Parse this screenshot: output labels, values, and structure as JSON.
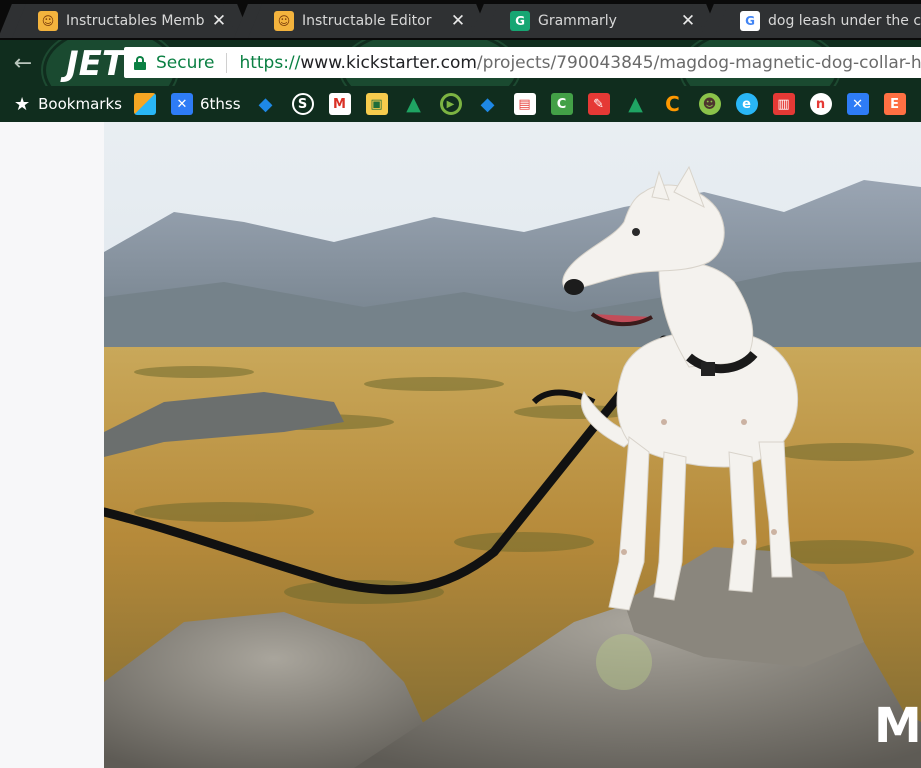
{
  "tabs": [
    {
      "title": "Instructables Membe",
      "favicon": "instructables-icon",
      "close": "✕"
    },
    {
      "title": "Instructable Editor",
      "favicon": "instructables-icon",
      "close": "✕"
    },
    {
      "title": "Grammarly",
      "favicon": "grammarly-icon",
      "close": "✕"
    },
    {
      "title": "dog leash under the c",
      "favicon": "google-icon",
      "close": "✕"
    }
  ],
  "toolbar": {
    "back": "←",
    "security_label": "Secure",
    "url": {
      "scheme": "https://",
      "host": "www.kickstarter.com",
      "path": "/projects/790043845/magdog-magnetic-dog-collar-h"
    },
    "theme_text": "JETS"
  },
  "bookmarks": {
    "label": "Bookmarks",
    "items": [
      {
        "icon": "folder-colorful-icon",
        "color": "#f5a623"
      },
      {
        "icon": "cross-x-icon",
        "color": "#2e7cf6",
        "label": "6thss"
      },
      {
        "icon": "diamond-icon",
        "color": "#1e88e5"
      },
      {
        "icon": "s-circle-icon",
        "color": "#ffffff"
      },
      {
        "icon": "gmail-icon",
        "color": "#d93025"
      },
      {
        "icon": "google-classroom-icon",
        "color": "#f7cb4d"
      },
      {
        "icon": "google-drive-icon",
        "color": "#1fa463"
      },
      {
        "icon": "play-ring-icon",
        "color": "#7cb342"
      },
      {
        "icon": "diamond-icon",
        "color": "#1e88e5"
      },
      {
        "icon": "store-icon",
        "color": "#e53935"
      },
      {
        "icon": "c-square-icon",
        "color": "#43a047"
      },
      {
        "icon": "paint-icon",
        "color": "#e53935"
      },
      {
        "icon": "google-drive-icon",
        "color": "#1fa463"
      },
      {
        "icon": "pacman-c-icon",
        "color": "#ff9800"
      },
      {
        "icon": "zombie-icon",
        "color": "#8bc34a"
      },
      {
        "icon": "globe-e-icon",
        "color": "#29b6f6"
      },
      {
        "icon": "bars-icon",
        "color": "#e53935"
      },
      {
        "icon": "n-circle-icon",
        "color": "#e53935"
      },
      {
        "icon": "cross-x-icon",
        "color": "#2e7cf6"
      },
      {
        "icon": "e-square-icon",
        "color": "#ff7043"
      }
    ]
  },
  "hero": {
    "watermark": "M",
    "description": "white-dog-on-rock-with-leash"
  },
  "colors": {
    "tabstrip": "#0a0a0a",
    "tab": "#2f3133",
    "toolbar": "#102d1e",
    "secure_green": "#0b8043"
  }
}
